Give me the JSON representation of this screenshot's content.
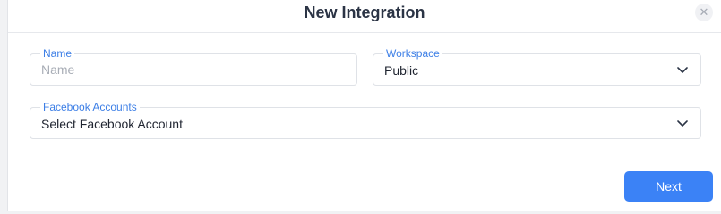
{
  "modal": {
    "title": "New Integration",
    "close_icon": "close-icon",
    "close_glyph": "✕"
  },
  "form": {
    "name": {
      "label": "Name",
      "placeholder": "Name",
      "value": ""
    },
    "workspace": {
      "label": "Workspace",
      "selected": "Public",
      "icon": "chevron-down-icon"
    },
    "facebook_accounts": {
      "label": "Facebook Accounts",
      "selected": "Select Facebook Account",
      "icon": "chevron-down-icon"
    }
  },
  "footer": {
    "next_label": "Next"
  },
  "colors": {
    "accent": "#3b82f6",
    "label": "#3d7fe6",
    "title": "#2b3445"
  }
}
